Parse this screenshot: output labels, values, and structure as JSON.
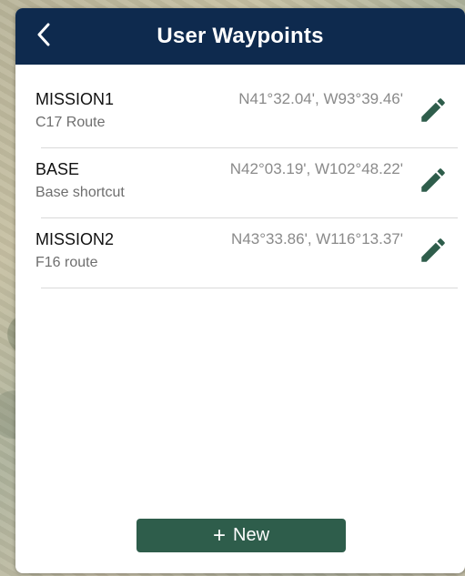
{
  "header": {
    "title": "User Waypoints",
    "back_icon": "chevron-left-icon"
  },
  "waypoints": [
    {
      "name": "MISSION1",
      "description": "C17 Route",
      "coordinates": "N41°32.04', W93°39.46'"
    },
    {
      "name": "BASE",
      "description": "Base shortcut",
      "coordinates": "N42°03.19', W102°48.22'"
    },
    {
      "name": "MISSION2",
      "description": "F16 route",
      "coordinates": "N43°33.86', W116°13.37'"
    }
  ],
  "new_button": {
    "icon": "+",
    "label": "New"
  },
  "colors": {
    "header_bg": "#0e2a4e",
    "accent_green": "#2e5d4b",
    "edit_icon": "#2e5d4b"
  }
}
